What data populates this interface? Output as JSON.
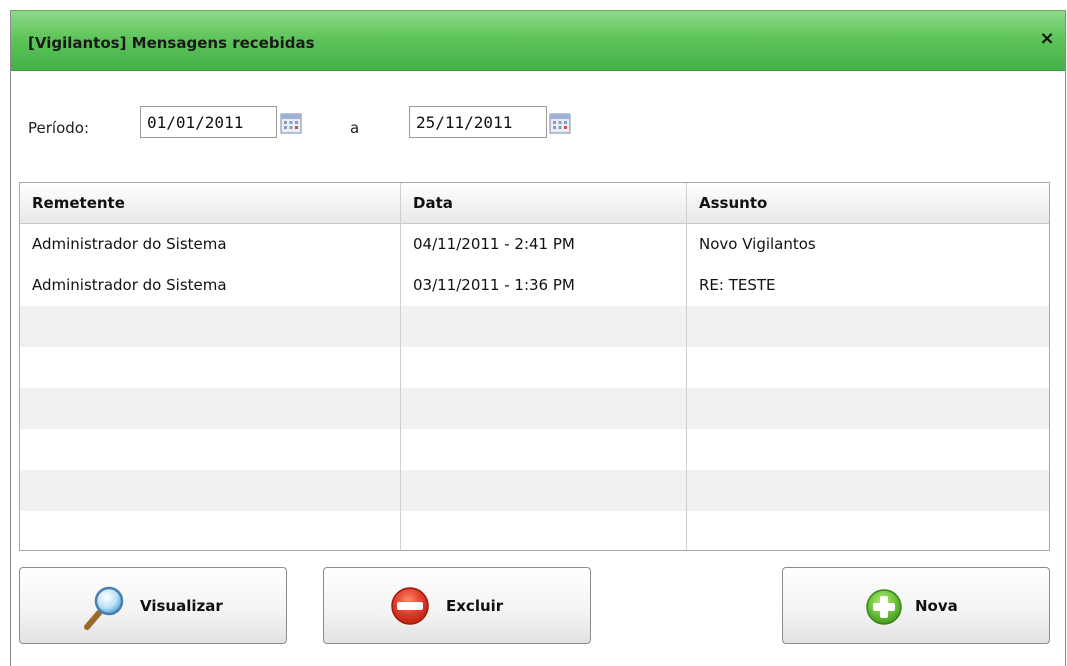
{
  "window": {
    "title": "[Vigilantos] Mensagens recebidas",
    "close_label": "×"
  },
  "filter": {
    "period_label": "Período:",
    "from_value": "01/01/2011",
    "separator": "a",
    "to_value": "25/11/2011"
  },
  "table": {
    "columns": [
      "Remetente",
      "Data",
      "Assunto"
    ],
    "rows": [
      [
        "Administrador do Sistema",
        "04/11/2011 - 2:41 PM",
        "Novo Vigilantos"
      ],
      [
        "Administrador do Sistema",
        "03/11/2011 - 1:36 PM",
        "RE: TESTE"
      ]
    ]
  },
  "buttons": {
    "view": {
      "label": "Visualizar",
      "icon": "magnifier-icon"
    },
    "delete": {
      "label": "Excluir",
      "icon": "minus-circle-icon"
    },
    "new": {
      "label": "Nova",
      "icon": "plus-circle-icon"
    }
  },
  "colors": {
    "titlebar": "#5fc55a",
    "delete_icon": "#e03a2a",
    "new_icon": "#6cc23a"
  }
}
